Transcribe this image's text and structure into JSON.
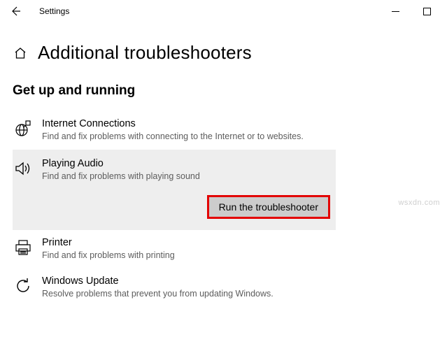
{
  "titlebar": {
    "app_name": "Settings"
  },
  "header": {
    "title": "Additional troubleshooters"
  },
  "section": {
    "heading": "Get up and running"
  },
  "items": [
    {
      "title": "Internet Connections",
      "desc": "Find and fix problems with connecting to the Internet or to websites."
    },
    {
      "title": "Playing Audio",
      "desc": "Find and fix problems with playing sound"
    },
    {
      "title": "Printer",
      "desc": "Find and fix problems with printing"
    },
    {
      "title": "Windows Update",
      "desc": "Resolve problems that prevent you from updating Windows."
    }
  ],
  "run_button": {
    "label": "Run the troubleshooter"
  },
  "watermark": "wsxdn.com"
}
